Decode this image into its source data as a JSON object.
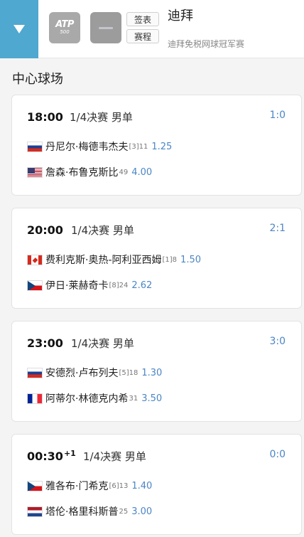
{
  "header": {
    "atp_logo_text": "ATP",
    "atp_logo_number": "500",
    "draw_button": "签表",
    "schedule_button": "赛程",
    "title": "迪拜",
    "subtitle": "迪拜免税网球冠军赛"
  },
  "court_name": "中心球场",
  "matches": [
    {
      "time": "18:00",
      "day_offset": "",
      "round": "1/4决赛 男单",
      "score": "1:0",
      "players": [
        {
          "flag": "russia-flag",
          "name": "丹尼尔·梅德韦杰夫",
          "seed": "[3]11",
          "odds": "1.25"
        },
        {
          "flag": "usa-flag",
          "name": "詹森·布鲁克斯比",
          "seed": "49",
          "odds": "4.00"
        }
      ]
    },
    {
      "time": "20:00",
      "day_offset": "",
      "round": "1/4决赛 男单",
      "score": "2:1",
      "players": [
        {
          "flag": "canada-flag",
          "name": "费利克斯·奥热-阿利亚西姆",
          "seed": "[1]8",
          "odds": "1.50"
        },
        {
          "flag": "czech-flag",
          "name": "伊日·莱赫奇卡",
          "seed": "[8]24",
          "odds": "2.62"
        }
      ]
    },
    {
      "time": "23:00",
      "day_offset": "",
      "round": "1/4决赛 男单",
      "score": "3:0",
      "players": [
        {
          "flag": "russia-flag",
          "name": "安德烈·卢布列夫",
          "seed": "[5]18",
          "odds": "1.30"
        },
        {
          "flag": "france-flag",
          "name": "阿蒂尔·林德克内希",
          "seed": "31",
          "odds": "3.50"
        }
      ]
    },
    {
      "time": "00:30",
      "day_offset": "+1",
      "round": "1/4决赛 男单",
      "score": "0:0",
      "players": [
        {
          "flag": "czech-flag",
          "name": "雅各布·门希克",
          "seed": "[6]13",
          "odds": "1.40"
        },
        {
          "flag": "netherlands-flag",
          "name": "塔伦·格里科斯普",
          "seed": "25",
          "odds": "3.00"
        }
      ]
    }
  ],
  "colors": {
    "accent": "#4ea8cf",
    "link": "#4a86c5"
  }
}
